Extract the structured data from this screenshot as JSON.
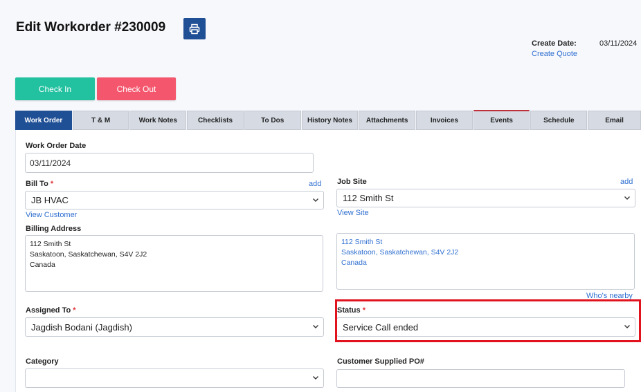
{
  "header": {
    "title": "Edit Workorder #230009",
    "create_date_label": "Create Date:",
    "create_date_value": "03/11/2024",
    "create_quote_link": "Create Quote"
  },
  "actions": {
    "check_in": "Check In",
    "check_out": "Check Out"
  },
  "tabs": [
    {
      "label": "Work Order",
      "active": true
    },
    {
      "label": "T & M"
    },
    {
      "label": "Work Notes"
    },
    {
      "label": "Checklists"
    },
    {
      "label": "To Dos"
    },
    {
      "label": "History Notes"
    },
    {
      "label": "Attachments"
    },
    {
      "label": "Invoices"
    },
    {
      "label": "Events"
    },
    {
      "label": "Schedule"
    },
    {
      "label": "Email"
    }
  ],
  "form": {
    "work_order_date": {
      "label": "Work Order Date",
      "value": "03/11/2024"
    },
    "bill_to": {
      "label": "Bill To",
      "required_mark": "*",
      "add": "add",
      "value": "JB HVAC",
      "link": "View Customer"
    },
    "job_site": {
      "label": "Job Site",
      "add": "add",
      "value": "112 Smith St",
      "link": "View Site"
    },
    "billing_address": {
      "label": "Billing Address",
      "lines": [
        "112 Smith St",
        "Saskatoon, Saskatchewan, S4V 2J2",
        "Canada"
      ]
    },
    "site_address": {
      "lines": [
        "112 Smith St",
        "Saskatoon, Saskatchewan, S4V 2J2",
        "Canada"
      ],
      "nearby_link": "Who's nearby"
    },
    "assigned_to": {
      "label": "Assigned To",
      "required_mark": "*",
      "value": "Jagdish Bodani (Jagdish)"
    },
    "status": {
      "label": "Status",
      "required_mark": "*",
      "value": "Service Call ended"
    },
    "category": {
      "label": "Category",
      "value": ""
    },
    "customer_po": {
      "label": "Customer Supplied PO#",
      "value": ""
    }
  },
  "colors": {
    "primary": "#1f4f95",
    "check_in": "#22c1a0",
    "check_out": "#f4566d",
    "link": "#2f6fd0",
    "highlight": "#e0131f"
  }
}
